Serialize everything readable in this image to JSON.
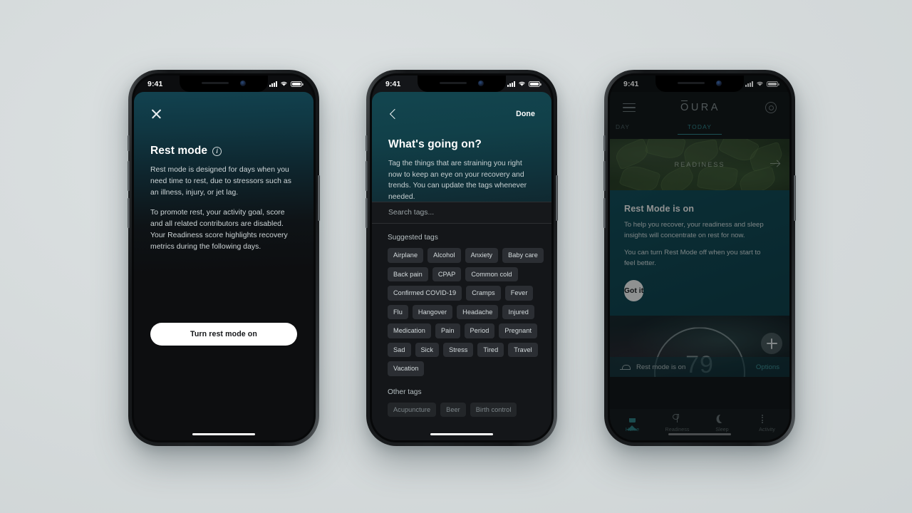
{
  "background_color": "#d7dcdd",
  "status_bar": {
    "time": "9:41",
    "signal_icon": "cellular-bars-icon",
    "wifi_icon": "wifi-icon",
    "battery_icon": "battery-icon"
  },
  "screen1": {
    "close_icon": "close-icon",
    "title": "Rest mode",
    "info_icon": "info-circle-icon",
    "info_glyph": "i",
    "paragraph1": "Rest mode is designed for days when you need time to rest, due to stressors such as an illness, injury, or jet lag.",
    "paragraph2": "To promote rest, your activity goal, score and all related contributors are disabled. Your Readiness score highlights recovery metrics during the following days.",
    "primary_button": "Turn rest mode on",
    "accent_color": "#12454f"
  },
  "screen2": {
    "back_icon": "chevron-left-icon",
    "done_label": "Done",
    "title": "What's going on?",
    "subtitle": "Tag the things that are straining you right now to keep an eye on your recovery and trends. You can update the tags whenever needed.",
    "search_placeholder": "Search tags...",
    "suggested_label": "Suggested tags",
    "suggested_tags": [
      [
        "Airplane",
        "Alcohol",
        "Anxiety",
        "Baby care"
      ],
      [
        "Back pain",
        "CPAP",
        "Common cold"
      ],
      [
        "Confirmed COVID-19",
        "Cramps",
        "Fever"
      ],
      [
        "Flu",
        "Hangover",
        "Headache",
        "Injured"
      ],
      [
        "Medication",
        "Pain",
        "Period",
        "Pregnant"
      ],
      [
        "Sad",
        "Sick",
        "Stress",
        "Tired",
        "Travel"
      ],
      [
        "Vacation"
      ]
    ],
    "other_label": "Other tags",
    "other_tags": [
      "Acupuncture",
      "Beer",
      "Birth control"
    ]
  },
  "screen3": {
    "menu_icon": "hamburger-menu-icon",
    "brand": "OURA",
    "settings_icon": "gear-icon",
    "tab_previous": "DAY",
    "tab_current": "TODAY",
    "readiness_card_label": "READINESS",
    "readiness_arrow_icon": "arrow-right-icon",
    "rest_title": "Rest Mode is on",
    "rest_paragraph1": "To help you recover, your readiness and sleep insights will concentrate on rest for now.",
    "rest_paragraph2": "You can turn Rest Mode off when you start to feel better.",
    "rest_button": "Got it",
    "score_value": "79",
    "add_icon": "plus-icon",
    "rest_status_icon": "bed-icon",
    "rest_status_text": "Rest mode is on",
    "options_link": "Options",
    "nav": [
      {
        "label": "Home",
        "icon": "home-icon",
        "active": true
      },
      {
        "label": "Readiness",
        "icon": "leaf-icon",
        "active": false
      },
      {
        "label": "Sleep",
        "icon": "moon-icon",
        "active": false
      },
      {
        "label": "Activity",
        "icon": "activity-list-icon",
        "active": false
      }
    ],
    "accent_color": "#2d8288",
    "card_color": "#0d4653"
  }
}
